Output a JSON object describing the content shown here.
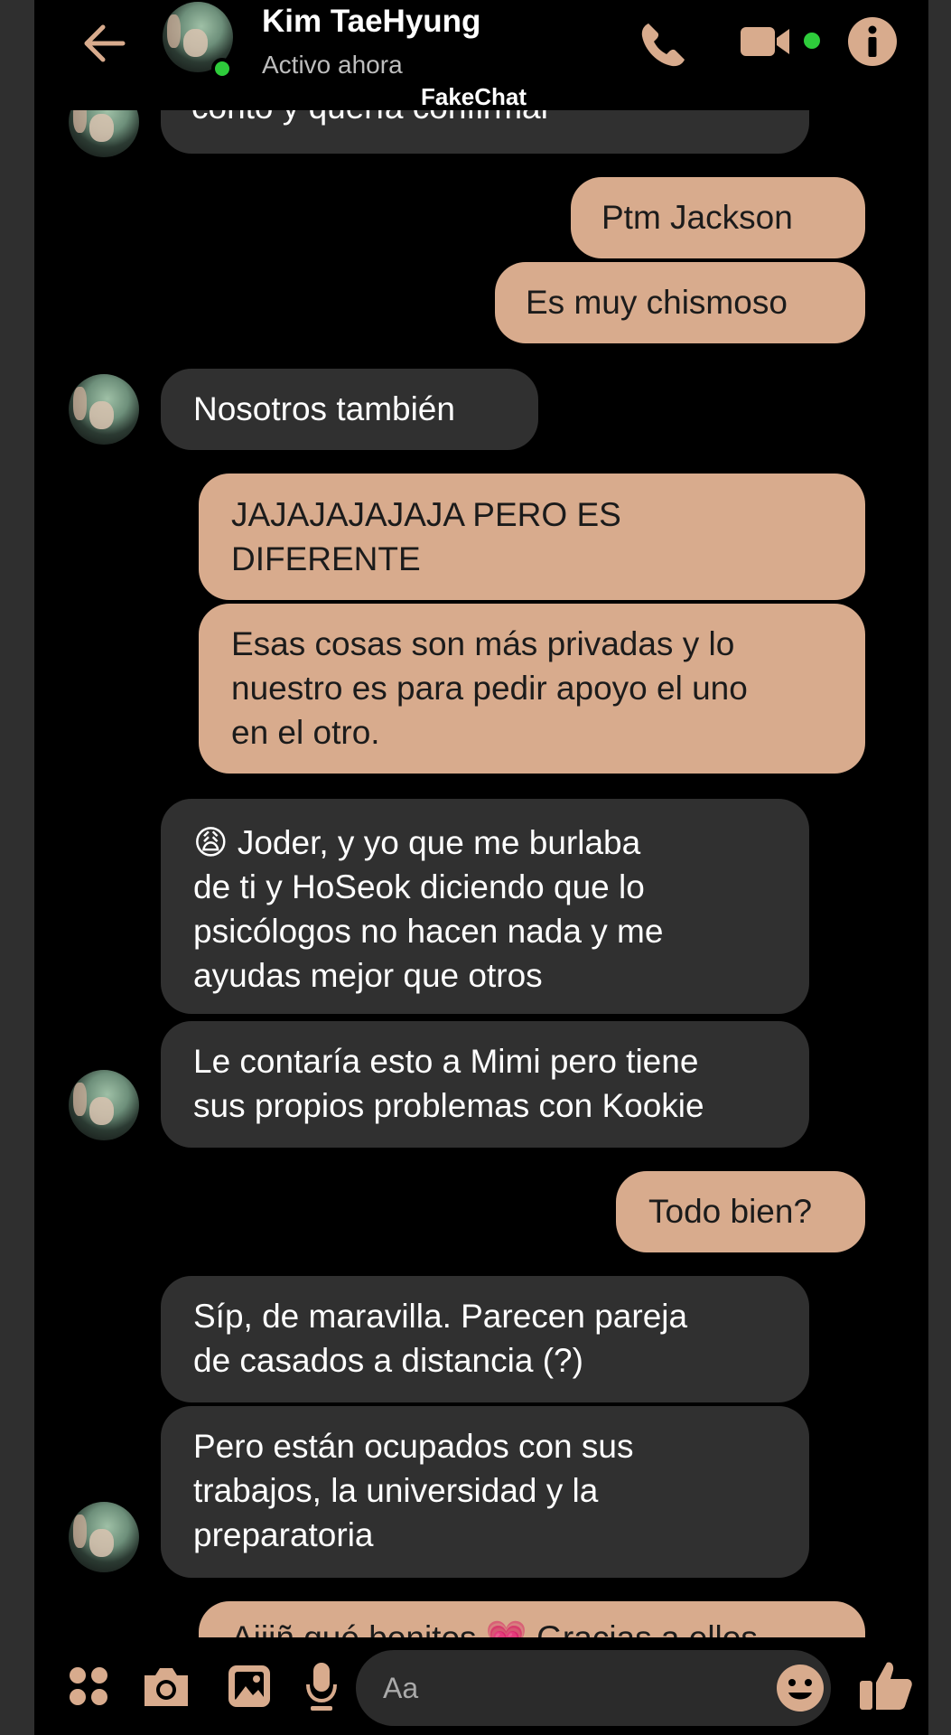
{
  "header": {
    "contact_name": "Kim TaeHyung",
    "status": "Activo ahora",
    "watermark": "FakeChat"
  },
  "messages": {
    "m0": "contó y quería confirmar",
    "m1": "Ptm Jackson",
    "m2": "Es muy chismoso",
    "m3": "Nosotros también",
    "m4": "JAJAJAJAJAJA PERO ES\nDIFERENTE",
    "m5": "Esas cosas son más privadas y lo\nnuestro es para pedir apoyo el uno\nen el otro.",
    "m6_emoji": "😩",
    "m6": " Joder, y yo que me burlaba\nde ti y HoSeok diciendo que lo\npsicólogos no hacen nada y me\nayudas mejor que otros",
    "m7": "Le contaría esto a Mimi pero tiene\nsus propios problemas con Kookie",
    "m8": "Todo bien?",
    "m9": "Síp, de maravilla. Parecen pareja\nde casados a distancia (?)",
    "m10": "Pero están ocupados con sus\ntrabajos, la universidad y la\npreparatoria",
    "m11": "Aiiiñ qué bonitos 💗 Gracias a ellos"
  },
  "composer": {
    "placeholder": "Aa"
  },
  "icons": {
    "back": "arrow-left-icon",
    "call": "phone-icon",
    "video": "video-camera-icon",
    "info": "info-icon",
    "menu": "four-dots-icon",
    "camera": "camera-icon",
    "gallery": "image-icon",
    "mic": "microphone-icon",
    "emoji": "smiley-icon",
    "like": "thumbs-up-icon"
  },
  "colors": {
    "accent": "#d8ab8d",
    "sent_bubble": "#d8ab8d",
    "received_bubble": "#303030",
    "online": "#2ecc3b"
  }
}
